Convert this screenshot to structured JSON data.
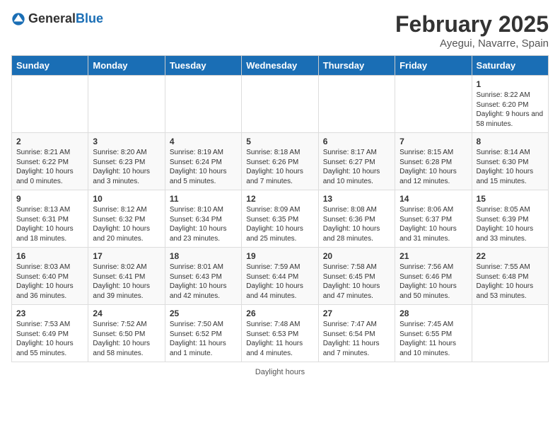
{
  "header": {
    "logo_general": "General",
    "logo_blue": "Blue",
    "month_title": "February 2025",
    "location": "Ayegui, Navarre, Spain"
  },
  "days_of_week": [
    "Sunday",
    "Monday",
    "Tuesday",
    "Wednesday",
    "Thursday",
    "Friday",
    "Saturday"
  ],
  "weeks": [
    [
      {
        "day": "",
        "info": ""
      },
      {
        "day": "",
        "info": ""
      },
      {
        "day": "",
        "info": ""
      },
      {
        "day": "",
        "info": ""
      },
      {
        "day": "",
        "info": ""
      },
      {
        "day": "",
        "info": ""
      },
      {
        "day": "1",
        "info": "Sunrise: 8:22 AM\nSunset: 6:20 PM\nDaylight: 9 hours and 58 minutes."
      }
    ],
    [
      {
        "day": "2",
        "info": "Sunrise: 8:21 AM\nSunset: 6:22 PM\nDaylight: 10 hours and 0 minutes."
      },
      {
        "day": "3",
        "info": "Sunrise: 8:20 AM\nSunset: 6:23 PM\nDaylight: 10 hours and 3 minutes."
      },
      {
        "day": "4",
        "info": "Sunrise: 8:19 AM\nSunset: 6:24 PM\nDaylight: 10 hours and 5 minutes."
      },
      {
        "day": "5",
        "info": "Sunrise: 8:18 AM\nSunset: 6:26 PM\nDaylight: 10 hours and 7 minutes."
      },
      {
        "day": "6",
        "info": "Sunrise: 8:17 AM\nSunset: 6:27 PM\nDaylight: 10 hours and 10 minutes."
      },
      {
        "day": "7",
        "info": "Sunrise: 8:15 AM\nSunset: 6:28 PM\nDaylight: 10 hours and 12 minutes."
      },
      {
        "day": "8",
        "info": "Sunrise: 8:14 AM\nSunset: 6:30 PM\nDaylight: 10 hours and 15 minutes."
      }
    ],
    [
      {
        "day": "9",
        "info": "Sunrise: 8:13 AM\nSunset: 6:31 PM\nDaylight: 10 hours and 18 minutes."
      },
      {
        "day": "10",
        "info": "Sunrise: 8:12 AM\nSunset: 6:32 PM\nDaylight: 10 hours and 20 minutes."
      },
      {
        "day": "11",
        "info": "Sunrise: 8:10 AM\nSunset: 6:34 PM\nDaylight: 10 hours and 23 minutes."
      },
      {
        "day": "12",
        "info": "Sunrise: 8:09 AM\nSunset: 6:35 PM\nDaylight: 10 hours and 25 minutes."
      },
      {
        "day": "13",
        "info": "Sunrise: 8:08 AM\nSunset: 6:36 PM\nDaylight: 10 hours and 28 minutes."
      },
      {
        "day": "14",
        "info": "Sunrise: 8:06 AM\nSunset: 6:37 PM\nDaylight: 10 hours and 31 minutes."
      },
      {
        "day": "15",
        "info": "Sunrise: 8:05 AM\nSunset: 6:39 PM\nDaylight: 10 hours and 33 minutes."
      }
    ],
    [
      {
        "day": "16",
        "info": "Sunrise: 8:03 AM\nSunset: 6:40 PM\nDaylight: 10 hours and 36 minutes."
      },
      {
        "day": "17",
        "info": "Sunrise: 8:02 AM\nSunset: 6:41 PM\nDaylight: 10 hours and 39 minutes."
      },
      {
        "day": "18",
        "info": "Sunrise: 8:01 AM\nSunset: 6:43 PM\nDaylight: 10 hours and 42 minutes."
      },
      {
        "day": "19",
        "info": "Sunrise: 7:59 AM\nSunset: 6:44 PM\nDaylight: 10 hours and 44 minutes."
      },
      {
        "day": "20",
        "info": "Sunrise: 7:58 AM\nSunset: 6:45 PM\nDaylight: 10 hours and 47 minutes."
      },
      {
        "day": "21",
        "info": "Sunrise: 7:56 AM\nSunset: 6:46 PM\nDaylight: 10 hours and 50 minutes."
      },
      {
        "day": "22",
        "info": "Sunrise: 7:55 AM\nSunset: 6:48 PM\nDaylight: 10 hours and 53 minutes."
      }
    ],
    [
      {
        "day": "23",
        "info": "Sunrise: 7:53 AM\nSunset: 6:49 PM\nDaylight: 10 hours and 55 minutes."
      },
      {
        "day": "24",
        "info": "Sunrise: 7:52 AM\nSunset: 6:50 PM\nDaylight: 10 hours and 58 minutes."
      },
      {
        "day": "25",
        "info": "Sunrise: 7:50 AM\nSunset: 6:52 PM\nDaylight: 11 hours and 1 minute."
      },
      {
        "day": "26",
        "info": "Sunrise: 7:48 AM\nSunset: 6:53 PM\nDaylight: 11 hours and 4 minutes."
      },
      {
        "day": "27",
        "info": "Sunrise: 7:47 AM\nSunset: 6:54 PM\nDaylight: 11 hours and 7 minutes."
      },
      {
        "day": "28",
        "info": "Sunrise: 7:45 AM\nSunset: 6:55 PM\nDaylight: 11 hours and 10 minutes."
      },
      {
        "day": "",
        "info": ""
      }
    ]
  ],
  "footer": "Daylight hours"
}
